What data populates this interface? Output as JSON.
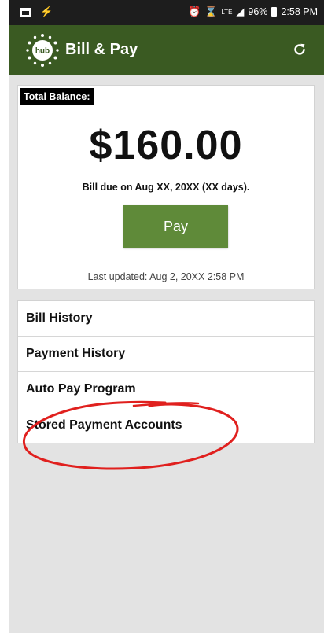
{
  "status_bar": {
    "signal_text": "LTE",
    "battery": "96%",
    "time": "2:58 PM"
  },
  "app_bar": {
    "logo_text": "hub",
    "title": "Bill & Pay",
    "refresh_icon": "refresh-icon"
  },
  "balance": {
    "label": "Total Balance:",
    "amount": "$160.00",
    "due_text": "Bill due on Aug XX, 20XX (XX days).",
    "pay_label": "Pay",
    "last_updated": "Last updated: Aug 2, 20XX 2:58 PM"
  },
  "menu": {
    "items": [
      {
        "label": "Bill History"
      },
      {
        "label": "Payment History"
      },
      {
        "label": "Auto Pay Program"
      },
      {
        "label": "Stored Payment Accounts"
      }
    ]
  },
  "colors": {
    "app_bar": "#3a5a22",
    "pay_button": "#5f8a39",
    "annotation": "#e0201e",
    "status_bar": "#1d1d1d"
  }
}
